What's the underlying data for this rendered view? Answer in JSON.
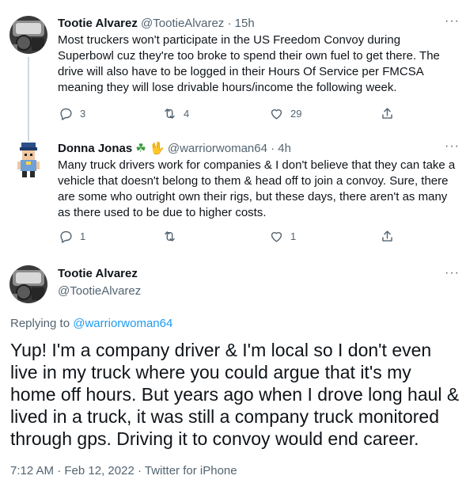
{
  "tweet1": {
    "name": "Tootie Alvarez",
    "handle": "@TootieAlvarez",
    "separator": "·",
    "time": "15h",
    "text": "Most truckers won't participate in the US Freedom Convoy during Superbowl cuz they're too broke to spend their own fuel to get there. The drive will also have to be logged in their Hours Of Service per FMCSA meaning they will lose drivable hours/income the following week.",
    "reply_count": "3",
    "retweet_count": "4",
    "like_count": "29",
    "more_label": "···"
  },
  "tweet2": {
    "name": "Donna Jonas",
    "emoji1": "☘",
    "emoji2": "🖖",
    "handle": "@warriorwoman64",
    "separator": "·",
    "time": "4h",
    "text": "Many truck drivers work for companies & I don't believe that they can take a vehicle that doesn't belong to them & head off to join a convoy. Sure, there are some who outright own their rigs, but these days, there aren't as many as there used to be due to higher costs.",
    "reply_count": "1",
    "retweet_count": "",
    "like_count": "1",
    "more_label": "···"
  },
  "main_tweet": {
    "name": "Tootie Alvarez",
    "handle": "@TootieAlvarez",
    "replying_prefix": "Replying to",
    "replying_handle": "@warriorwoman64",
    "text": "Yup! I'm a company driver & I'm local so I don't even live in my truck where you could argue that it's my home off hours. But years ago when I drove long haul & lived in a truck, it was still a company truck monitored through gps. Driving it to convoy would end career.",
    "time": "7:12 AM",
    "date": "Feb 12, 2022",
    "source": "Twitter for iPhone",
    "separator": "·",
    "more_label": "···"
  },
  "colors": {
    "accent": "#1d9bf0",
    "secondary_text": "#536471",
    "thread_line": "#cfd9de"
  }
}
